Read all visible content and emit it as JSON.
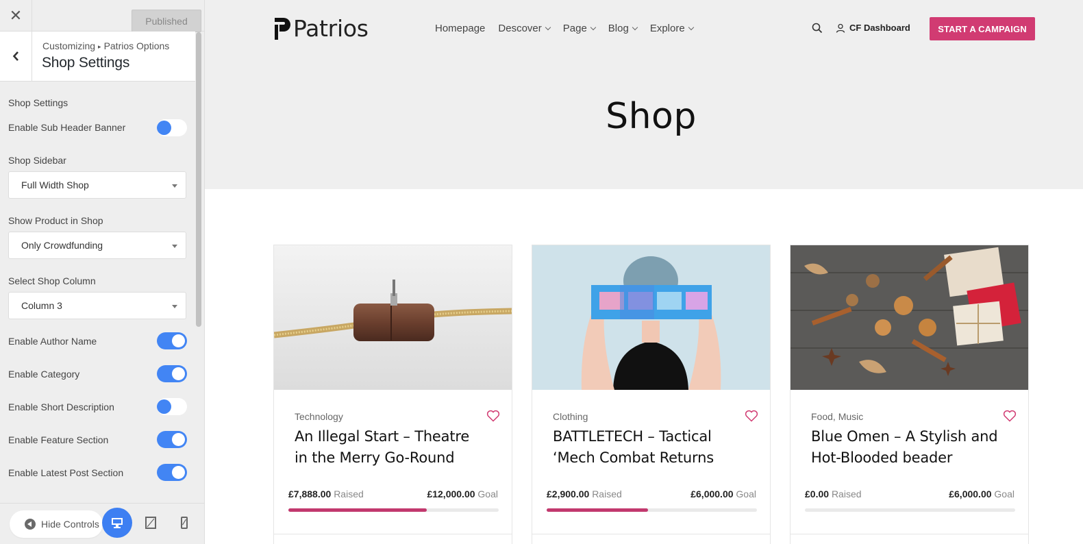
{
  "customizer": {
    "close_icon": "close-icon",
    "publish_label": "Published",
    "breadcrumb": {
      "root": "Customizing",
      "separator": "▸",
      "parent": "Patrios Options"
    },
    "section_title": "Shop Settings",
    "group_title": "Shop Settings",
    "sub_header_banner": {
      "label": "Enable Sub Header Banner",
      "enabled": false
    },
    "shop_sidebar": {
      "label": "Shop Sidebar",
      "value": "Full Width Shop"
    },
    "show_product": {
      "label": "Show Product in Shop",
      "value": "Only Crowdfunding"
    },
    "shop_column": {
      "label": "Select Shop Column",
      "value": "Column 3"
    },
    "toggles": [
      {
        "label": "Enable Author Name",
        "enabled": true
      },
      {
        "label": "Enable Category",
        "enabled": true
      },
      {
        "label": "Enable Short Description",
        "enabled": false
      },
      {
        "label": "Enable Feature Section",
        "enabled": true
      },
      {
        "label": "Enable Latest Post Section",
        "enabled": true
      }
    ],
    "footer": {
      "hide_controls_label": "Hide Controls",
      "devices": [
        "desktop-icon",
        "tablet-icon",
        "mobile-icon"
      ],
      "active_device": "desktop"
    },
    "accent_color": "#4285f4"
  },
  "site": {
    "logo_text": "Patrios",
    "nav": [
      {
        "label": "Homepage",
        "dropdown": false
      },
      {
        "label": "Descover",
        "dropdown": true
      },
      {
        "label": "Page",
        "dropdown": true
      },
      {
        "label": "Blog",
        "dropdown": true
      },
      {
        "label": "Explore",
        "dropdown": true
      }
    ],
    "dashboard_label": "CF Dashboard",
    "cta_label": "START A CAMPAIGN",
    "brand_color": "#d13b72",
    "page_title": "Shop",
    "products": [
      {
        "category": "Technology",
        "title": "An Illegal Start – Theatre in the Merry Go-Round",
        "raised": "£7,888.00",
        "raised_label": "Raised",
        "goal": "£12,000.00",
        "goal_label": "Goal",
        "progress": 0.657,
        "image": "wooden-cable-toggle-image"
      },
      {
        "category": "Clothing",
        "title": "BATTLETECH – Tactical ‘Mech Combat Returns",
        "raised": "£2,900.00",
        "raised_label": "Raised",
        "goal": "£6,000.00",
        "goal_label": "Goal",
        "progress": 0.483,
        "image": "woman-holding-glasses-image"
      },
      {
        "category": "Food, Music",
        "title": "Blue Omen – A Stylish and Hot-Blooded beader",
        "raised": "£0.00",
        "raised_label": "Raised",
        "goal": "£6,000.00",
        "goal_label": "Goal",
        "progress": 0,
        "image": "spices-gifts-image"
      }
    ]
  }
}
